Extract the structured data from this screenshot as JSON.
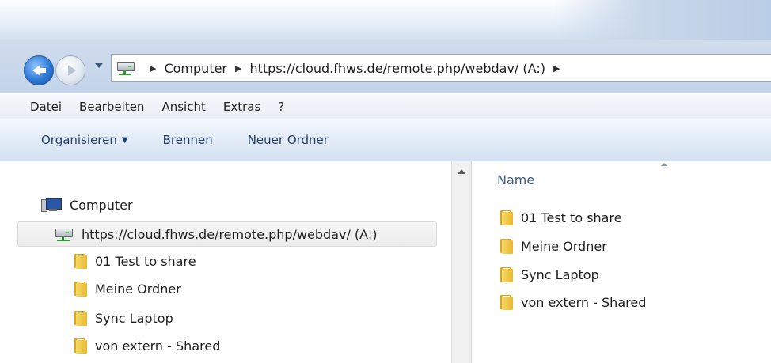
{
  "address_bar": {
    "crumbs": [
      "Computer",
      "https://cloud.fhws.de/remote.php/webdav/ (A:)"
    ]
  },
  "menu": [
    "Datei",
    "Bearbeiten",
    "Ansicht",
    "Extras",
    "?"
  ],
  "commands": {
    "organize": "Organisieren",
    "burn": "Brennen",
    "new_folder": "Neuer Ordner"
  },
  "nav_tree": {
    "computer": "Computer",
    "drive": "https://cloud.fhws.de/remote.php/webdav/ (A:)",
    "folders": [
      "01 Test to share",
      "Meine Ordner",
      "Sync Laptop",
      "von extern - Shared"
    ]
  },
  "content": {
    "column_name": "Name",
    "items": [
      "01 Test to share",
      "Meine Ordner",
      "Sync Laptop",
      "von extern - Shared"
    ]
  },
  "colors": {
    "accent": "#2e7ad6",
    "folder": "#e8b82e"
  }
}
